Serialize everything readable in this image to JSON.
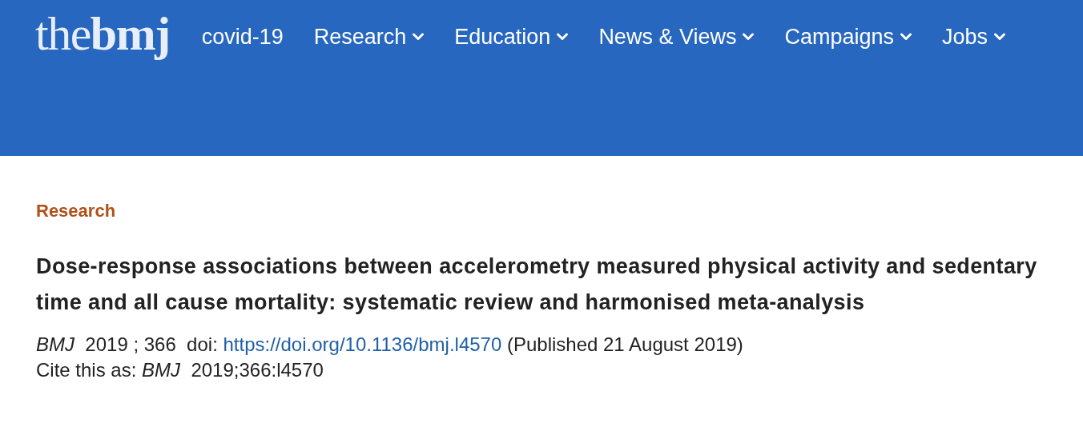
{
  "header": {
    "logo": "the**bmj**",
    "nav": [
      {
        "label": "covid-19",
        "dropdown": false
      },
      {
        "label": "Research",
        "dropdown": true
      },
      {
        "label": "Education",
        "dropdown": true
      },
      {
        "label": "News & Views",
        "dropdown": true
      },
      {
        "label": "Campaigns",
        "dropdown": true
      },
      {
        "label": "Jobs",
        "dropdown": true
      }
    ]
  },
  "article": {
    "section": "Research",
    "title": "Dose-response associations between accelerometry measured physical activity and sedentary time and all cause mortality: systematic review and harmonised meta-analysis",
    "citation": {
      "prefix": "*BMJ*  2019 ; 366  doi: ",
      "doi": "https://doi.org/10.1136/bmj.l4570",
      "published": "(Published 21 August 2019)"
    },
    "cite_as": "Cite this as: *BMJ*  2019;366:l4570"
  }
}
